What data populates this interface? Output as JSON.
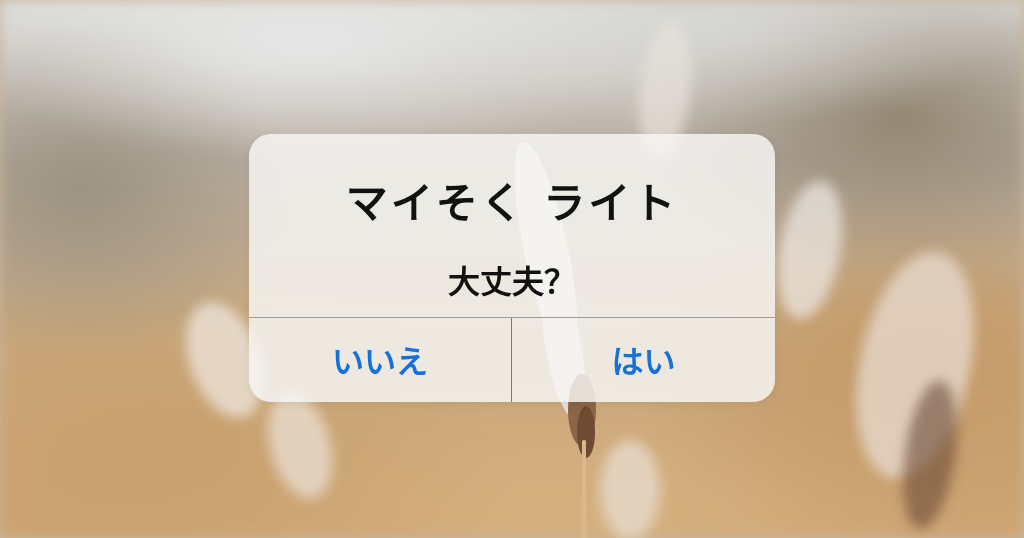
{
  "dialog": {
    "title": "マイそく ライト",
    "message": "大丈夫？",
    "buttons": {
      "no_label": "いいえ",
      "yes_label": "はい"
    }
  },
  "colors": {
    "button_text": "#1671d9",
    "title_text": "#111111",
    "dialog_bg": "#f6f5f3"
  }
}
